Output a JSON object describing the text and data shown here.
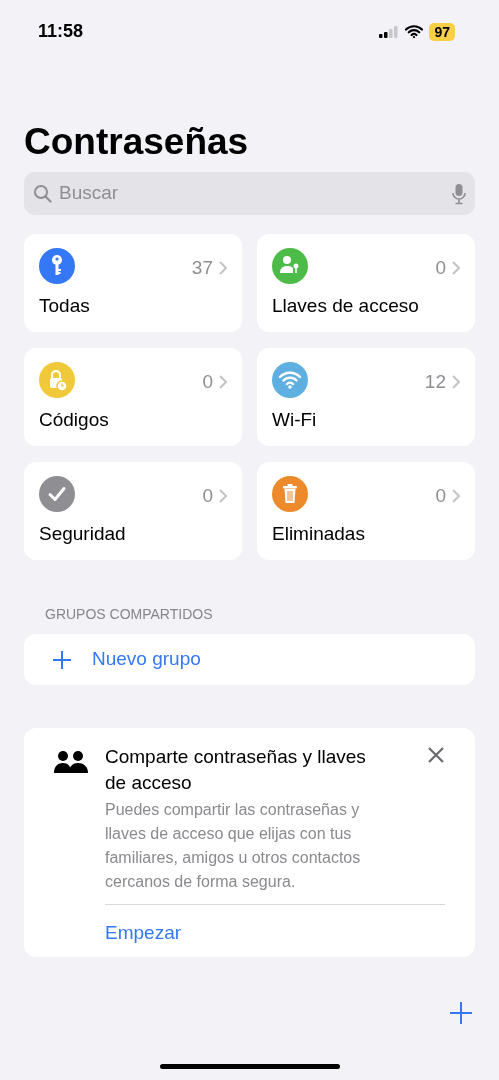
{
  "status_bar": {
    "time": "11:58",
    "battery": "97"
  },
  "title": "Contraseñas",
  "search": {
    "placeholder": "Buscar"
  },
  "categories": [
    {
      "label": "Todas",
      "count": "37",
      "kind": "key",
      "color": "#3478f6"
    },
    {
      "label": "Llaves de acceso",
      "count": "0",
      "kind": "passkey",
      "color": "#4cbb47"
    },
    {
      "label": "Códigos",
      "count": "0",
      "kind": "lock-clock",
      "color": "#f0c93a"
    },
    {
      "label": "Wi-Fi",
      "count": "12",
      "kind": "wifi",
      "color": "#5fb0e0"
    },
    {
      "label": "Seguridad",
      "count": "0",
      "kind": "check",
      "color": "#8e8e93"
    },
    {
      "label": "Eliminadas",
      "count": "0",
      "kind": "trash",
      "color": "#ec8a2c"
    }
  ],
  "shared_groups": {
    "header": "GRUPOS COMPARTIDOS",
    "new_group": "Nuevo grupo"
  },
  "share_card": {
    "title": "Comparte contraseñas y llaves de acceso",
    "description": "Puedes compartir las contraseñas y llaves de acceso que elijas con tus familiares, amigos u otros contactos cercanos de forma segura.",
    "action": "Empezar"
  }
}
